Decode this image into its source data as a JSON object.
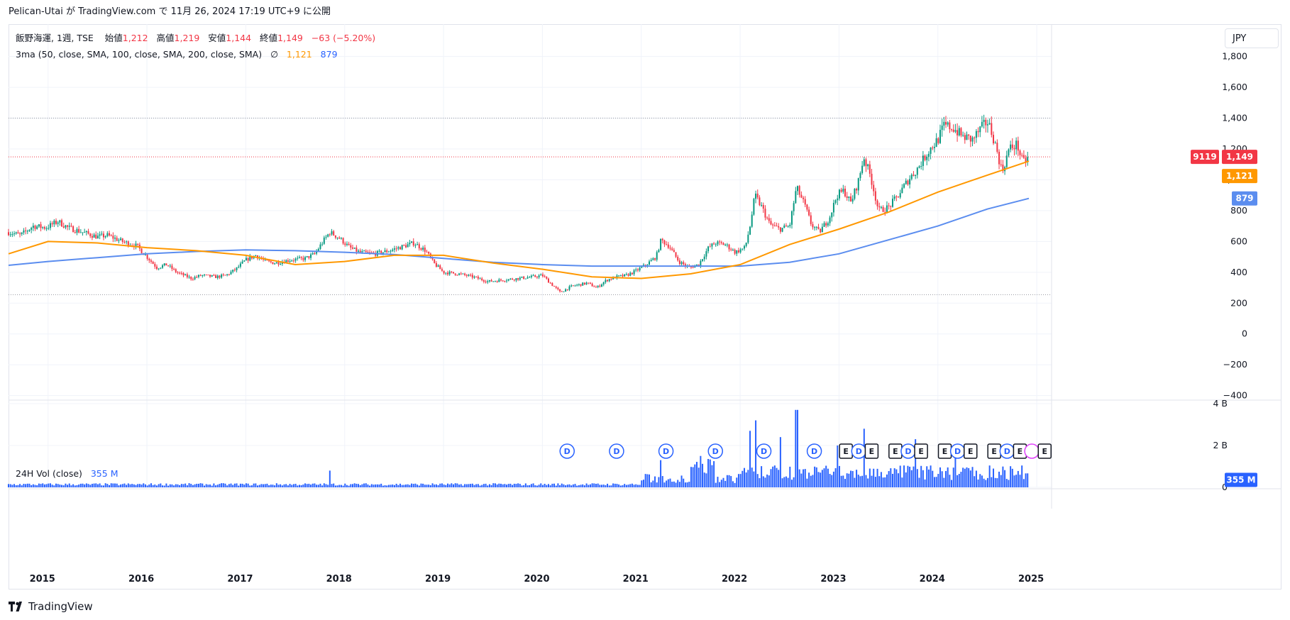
{
  "header": {
    "publisher_line": "Pelican-Utai が TradingView.com で 11月 26, 2024 17:19 UTC+9 に公開"
  },
  "legend": {
    "symbol": "飯野海運, 1週, TSE",
    "open_label": "始値",
    "open_value": "1,212",
    "high_label": "高値",
    "high_value": "1,219",
    "low_label": "安値",
    "low_value": "1,144",
    "close_label": "終値",
    "close_value": "1,149",
    "change": "−63 (−5.20%)",
    "ma_label": "3ma (50, close, SMA, 100, close, SMA, 200, close, SMA)",
    "ma_hidden_icon": "∅",
    "ma100_value": "1,121",
    "ma200_value": "879"
  },
  "volume_legend": {
    "label": "24H Vol (close)",
    "value": "355 M"
  },
  "currency": "JPY",
  "brand": {
    "name": "TradingView",
    "icon": "tradingview-logo-icon"
  },
  "colors": {
    "up": "#089981",
    "down": "#f23645",
    "ma100": "#ff9800",
    "ma200": "#5b8def",
    "volume": "#2962ff",
    "event_dividend": "#2962ff",
    "event_earnings": "#131722",
    "event_split": "#e040fb"
  },
  "tags": {
    "countdown": "9119",
    "last_price": "1,149",
    "ma100": "1,121",
    "ma200": "879",
    "volume": "355 M"
  },
  "chart_data": {
    "type": "candlestick",
    "interval": "1週",
    "x_ticks": [
      "2015",
      "2016",
      "2017",
      "2018",
      "2019",
      "2020",
      "2021",
      "2022",
      "2023",
      "2024",
      "2025"
    ],
    "y_ticks": [
      -400,
      -200,
      0,
      200,
      400,
      600,
      800,
      1000,
      1200,
      1400,
      1600,
      1800
    ],
    "y_tick_labels": [
      "−400",
      "−200",
      "0",
      "200",
      "400",
      "600",
      "800",
      "1,000",
      "1,200",
      "1,400",
      "1,600",
      "1,800"
    ],
    "ylim": [
      -420,
      2010
    ],
    "xlim": [
      2014.6,
      2025.15
    ],
    "horizontal_lines": [
      1400,
      1149,
      255
    ],
    "price_path": [
      [
        2014.6,
        660
      ],
      [
        2014.72,
        640
      ],
      [
        2014.85,
        700
      ],
      [
        2014.98,
        690
      ],
      [
        2015.1,
        730
      ],
      [
        2015.2,
        690
      ],
      [
        2015.35,
        660
      ],
      [
        2015.5,
        630
      ],
      [
        2015.6,
        640
      ],
      [
        2015.75,
        600
      ],
      [
        2015.9,
        570
      ],
      [
        2016.0,
        500
      ],
      [
        2016.1,
        430
      ],
      [
        2016.2,
        450
      ],
      [
        2016.3,
        400
      ],
      [
        2016.45,
        360
      ],
      [
        2016.55,
        380
      ],
      [
        2016.7,
        370
      ],
      [
        2016.8,
        380
      ],
      [
        2016.9,
        420
      ],
      [
        2017.0,
        480
      ],
      [
        2017.1,
        510
      ],
      [
        2017.2,
        470
      ],
      [
        2017.3,
        460
      ],
      [
        2017.45,
        480
      ],
      [
        2017.6,
        490
      ],
      [
        2017.7,
        520
      ],
      [
        2017.78,
        600
      ],
      [
        2017.85,
        660
      ],
      [
        2017.95,
        620
      ],
      [
        2018.05,
        560
      ],
      [
        2018.15,
        530
      ],
      [
        2018.3,
        520
      ],
      [
        2018.45,
        540
      ],
      [
        2018.55,
        560
      ],
      [
        2018.7,
        590
      ],
      [
        2018.82,
        540
      ],
      [
        2018.9,
        460
      ],
      [
        2019.0,
        400
      ],
      [
        2019.15,
        390
      ],
      [
        2019.3,
        370
      ],
      [
        2019.45,
        340
      ],
      [
        2019.6,
        350
      ],
      [
        2019.75,
        360
      ],
      [
        2019.9,
        370
      ],
      [
        2020.0,
        380
      ],
      [
        2020.08,
        330
      ],
      [
        2020.18,
        270
      ],
      [
        2020.3,
        310
      ],
      [
        2020.45,
        330
      ],
      [
        2020.55,
        300
      ],
      [
        2020.65,
        350
      ],
      [
        2020.75,
        370
      ],
      [
        2020.85,
        380
      ],
      [
        2020.95,
        410
      ],
      [
        2021.05,
        450
      ],
      [
        2021.15,
        500
      ],
      [
        2021.2,
        610
      ],
      [
        2021.28,
        570
      ],
      [
        2021.38,
        470
      ],
      [
        2021.48,
        430
      ],
      [
        2021.58,
        450
      ],
      [
        2021.68,
        560
      ],
      [
        2021.75,
        590
      ],
      [
        2021.85,
        580
      ],
      [
        2021.95,
        530
      ],
      [
        2022.05,
        560
      ],
      [
        2022.1,
        700
      ],
      [
        2022.15,
        900
      ],
      [
        2022.22,
        820
      ],
      [
        2022.3,
        710
      ],
      [
        2022.4,
        680
      ],
      [
        2022.5,
        700
      ],
      [
        2022.57,
        950
      ],
      [
        2022.65,
        840
      ],
      [
        2022.72,
        710
      ],
      [
        2022.8,
        660
      ],
      [
        2022.9,
        750
      ],
      [
        2022.98,
        900
      ],
      [
        2023.05,
        930
      ],
      [
        2023.12,
        850
      ],
      [
        2023.2,
        1000
      ],
      [
        2023.25,
        1150
      ],
      [
        2023.32,
        1020
      ],
      [
        2023.4,
        800
      ],
      [
        2023.5,
        820
      ],
      [
        2023.6,
        900
      ],
      [
        2023.7,
        1000
      ],
      [
        2023.78,
        1060
      ],
      [
        2023.85,
        1130
      ],
      [
        2023.92,
        1200
      ],
      [
        2024.0,
        1260
      ],
      [
        2024.06,
        1350
      ],
      [
        2024.15,
        1340
      ],
      [
        2024.25,
        1280
      ],
      [
        2024.35,
        1260
      ],
      [
        2024.42,
        1320
      ],
      [
        2024.5,
        1380
      ],
      [
        2024.55,
        1300
      ],
      [
        2024.6,
        1180
      ],
      [
        2024.65,
        1050
      ],
      [
        2024.72,
        1200
      ],
      [
        2024.8,
        1230
      ],
      [
        2024.86,
        1110
      ],
      [
        2024.92,
        1149
      ]
    ],
    "ma100": [
      [
        2014.6,
        520
      ],
      [
        2015.0,
        600
      ],
      [
        2015.5,
        590
      ],
      [
        2016.0,
        560
      ],
      [
        2016.5,
        540
      ],
      [
        2017.0,
        510
      ],
      [
        2017.5,
        450
      ],
      [
        2018.0,
        470
      ],
      [
        2018.5,
        510
      ],
      [
        2019.0,
        510
      ],
      [
        2019.5,
        460
      ],
      [
        2020.0,
        420
      ],
      [
        2020.5,
        370
      ],
      [
        2021.0,
        360
      ],
      [
        2021.5,
        390
      ],
      [
        2022.0,
        450
      ],
      [
        2022.5,
        580
      ],
      [
        2023.0,
        680
      ],
      [
        2023.5,
        790
      ],
      [
        2024.0,
        920
      ],
      [
        2024.5,
        1030
      ],
      [
        2024.92,
        1121
      ]
    ],
    "ma200": [
      [
        2014.6,
        445
      ],
      [
        2015.0,
        470
      ],
      [
        2015.5,
        495
      ],
      [
        2016.0,
        520
      ],
      [
        2016.5,
        535
      ],
      [
        2017.0,
        545
      ],
      [
        2017.5,
        540
      ],
      [
        2018.0,
        530
      ],
      [
        2018.5,
        515
      ],
      [
        2019.0,
        490
      ],
      [
        2019.5,
        465
      ],
      [
        2020.0,
        450
      ],
      [
        2020.5,
        440
      ],
      [
        2021.0,
        440
      ],
      [
        2021.5,
        440
      ],
      [
        2022.0,
        440
      ],
      [
        2022.5,
        465
      ],
      [
        2023.0,
        520
      ],
      [
        2023.5,
        610
      ],
      [
        2024.0,
        700
      ],
      [
        2024.5,
        810
      ],
      [
        2024.92,
        879
      ]
    ],
    "volume": {
      "label": "24H Vol (close)",
      "y_ticks": [
        0,
        2,
        4
      ],
      "y_tick_labels": [
        "0",
        "2 B",
        "4 B"
      ],
      "unit": "B",
      "ylim": [
        0,
        4.1
      ],
      "last": 0.355,
      "spikes": [
        [
          2017.85,
          0.8
        ],
        [
          2021.2,
          1.3
        ],
        [
          2021.6,
          1.5
        ],
        [
          2022.1,
          2.7
        ],
        [
          2022.15,
          3.2
        ],
        [
          2022.4,
          2.4
        ],
        [
          2022.57,
          3.7
        ],
        [
          2022.98,
          2.0
        ],
        [
          2023.25,
          2.8
        ],
        [
          2023.78,
          2.3
        ],
        [
          2024.18,
          2.0
        ]
      ]
    },
    "events": [
      {
        "x": 2020.25,
        "type": "D"
      },
      {
        "x": 2020.75,
        "type": "D"
      },
      {
        "x": 2021.25,
        "type": "D"
      },
      {
        "x": 2021.75,
        "type": "D"
      },
      {
        "x": 2022.24,
        "type": "D"
      },
      {
        "x": 2022.75,
        "type": "D"
      },
      {
        "x": 2023.07,
        "type": "E"
      },
      {
        "x": 2023.2,
        "type": "D"
      },
      {
        "x": 2023.33,
        "type": "E"
      },
      {
        "x": 2023.57,
        "type": "E"
      },
      {
        "x": 2023.7,
        "type": "D"
      },
      {
        "x": 2023.83,
        "type": "E"
      },
      {
        "x": 2024.07,
        "type": "E"
      },
      {
        "x": 2024.2,
        "type": "D"
      },
      {
        "x": 2024.33,
        "type": "E"
      },
      {
        "x": 2024.57,
        "type": "E"
      },
      {
        "x": 2024.7,
        "type": "D"
      },
      {
        "x": 2024.83,
        "type": "E"
      },
      {
        "x": 2024.95,
        "type": "S"
      },
      {
        "x": 2025.08,
        "type": "E"
      }
    ]
  }
}
